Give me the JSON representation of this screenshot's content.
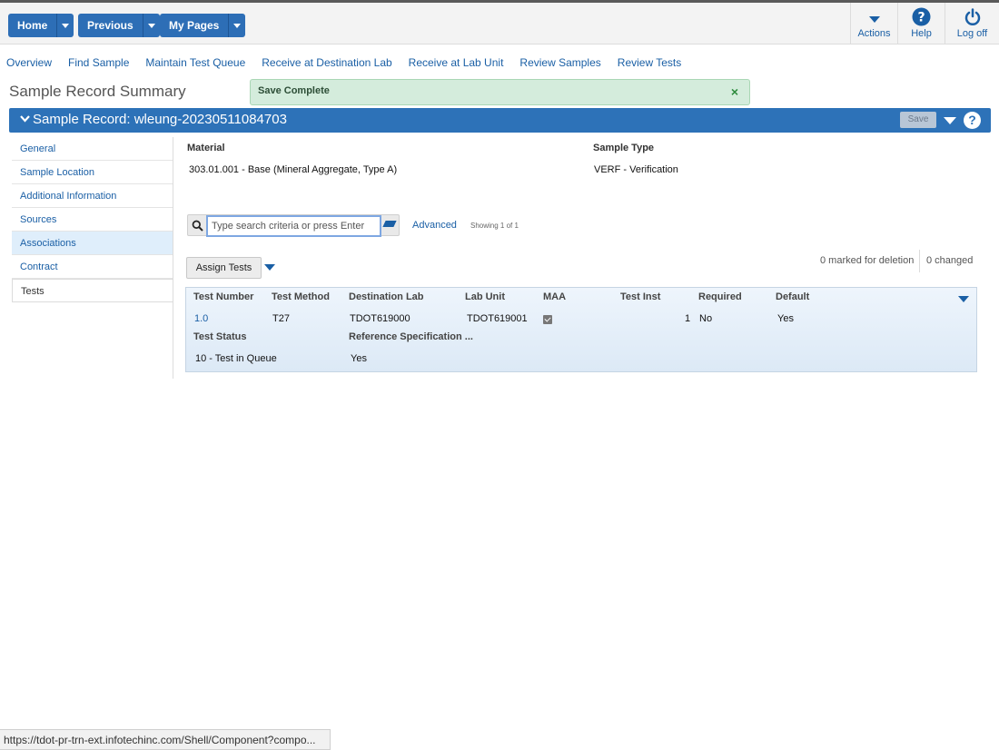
{
  "header": {
    "buttons": [
      {
        "label": "Home"
      },
      {
        "label": "Previous"
      },
      {
        "label": "My Pages"
      }
    ],
    "actions": [
      {
        "label": "Actions",
        "icon": "chevron-down-icon"
      },
      {
        "label": "Help",
        "icon": "help-icon"
      },
      {
        "label": "Log off",
        "icon": "power-icon"
      }
    ]
  },
  "nav": [
    "Overview",
    "Find Sample",
    "Maintain Test Queue",
    "Receive at Destination Lab",
    "Receive at Lab Unit",
    "Review Samples",
    "Review Tests"
  ],
  "page": {
    "title": "Sample Record Summary",
    "toast": "Save Complete",
    "toast_close": "×"
  },
  "record": {
    "title": "Sample Record: wleung-20230511084703",
    "save_label": "Save",
    "help_label": "?"
  },
  "sidebar": [
    "General",
    "Sample Location",
    "Additional Information",
    "Sources",
    "Associations",
    "Contract",
    "Tests"
  ],
  "details": {
    "material_label": "Material",
    "material_value": "303.01.001 - Base (Mineral Aggregate, Type A)",
    "sample_type_label": "Sample Type",
    "sample_type_value": "VERF - Verification"
  },
  "search": {
    "placeholder": "Type search criteria or press Enter",
    "advanced": "Advanced",
    "showing": "Showing 1 of 1"
  },
  "tests": {
    "assign_label": "Assign Tests",
    "marked_for_deletion": "0 marked for deletion",
    "changed": "0 changed",
    "columns": [
      "Test Number",
      "Test Method",
      "Destination Lab",
      "Lab Unit",
      "MAA",
      "Test Inst",
      "Required",
      "Default"
    ],
    "row": {
      "test_number": "1.0",
      "test_method": "T27",
      "destination_lab": "TDOT619000",
      "lab_unit": "TDOT619001",
      "maa_checked": true,
      "test_inst": "1",
      "required": "No",
      "default": "Yes",
      "test_status_label": "Test Status",
      "test_status": "10 - Test in Queue",
      "ref_spec_label": "Reference Specification ...",
      "ref_spec": "Yes"
    }
  },
  "status_bar": "https://tdot-pr-trn-ext.infotechinc.com/Shell/Component?compo..."
}
